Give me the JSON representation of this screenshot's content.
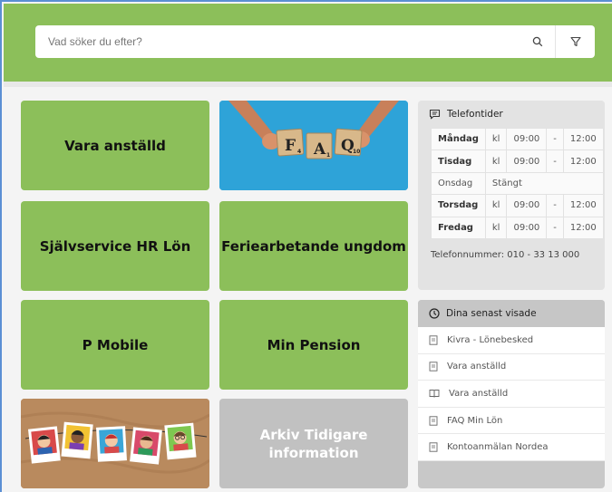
{
  "search": {
    "placeholder": "Vad söker du efter?",
    "search_icon": "search-icon",
    "filter_icon": "filter-icon"
  },
  "tiles": {
    "vara_anstalld": "Vara anställd",
    "sjalvservice": "Självservice HR Lön",
    "feriearbetande": "Feriearbetande ungdom",
    "p_mobile": "P Mobile",
    "min_pension": "Min Pension",
    "arkiv_line1": "Arkiv Tidigare",
    "arkiv_line2": "information",
    "faq_image": {
      "letters": [
        "F",
        "A",
        "Q"
      ],
      "subscripts": [
        "4",
        "1",
        "10"
      ]
    }
  },
  "phone": {
    "title": "Telefontider",
    "icon": "chat-icon",
    "rows": [
      {
        "day": "Måndag",
        "kl": "kl",
        "from": "09:00",
        "dash": "-",
        "to": "12:00",
        "closed": false
      },
      {
        "day": "Tisdag",
        "kl": "kl",
        "from": "09:00",
        "dash": "-",
        "to": "12:00",
        "closed": false
      },
      {
        "day": "Onsdag",
        "status": "Stängt",
        "closed": true
      },
      {
        "day": "Torsdag",
        "kl": "kl",
        "from": "09:00",
        "dash": "-",
        "to": "12:00",
        "closed": false
      },
      {
        "day": "Fredag",
        "kl": "kl",
        "from": "09:00",
        "dash": "-",
        "to": "12:00",
        "closed": false
      }
    ],
    "number": "Telefonnummer: 010 - 33 13 000"
  },
  "recent": {
    "title": "Dina senast visade",
    "icon": "clock-icon",
    "items": [
      {
        "label": "Kivra - Lönebesked",
        "icon": "document-icon"
      },
      {
        "label": "Vara anställd",
        "icon": "document-icon"
      },
      {
        "label": "Vara anställd",
        "icon": "book-icon"
      },
      {
        "label": "FAQ Min Lön",
        "icon": "document-icon"
      },
      {
        "label": "Kontoanmälan Nordea",
        "icon": "document-icon"
      }
    ]
  },
  "colors": {
    "brand_green": "#8cbf5a",
    "tile_grey": "#c1c1c1",
    "faq_blue": "#2ea3d8"
  }
}
